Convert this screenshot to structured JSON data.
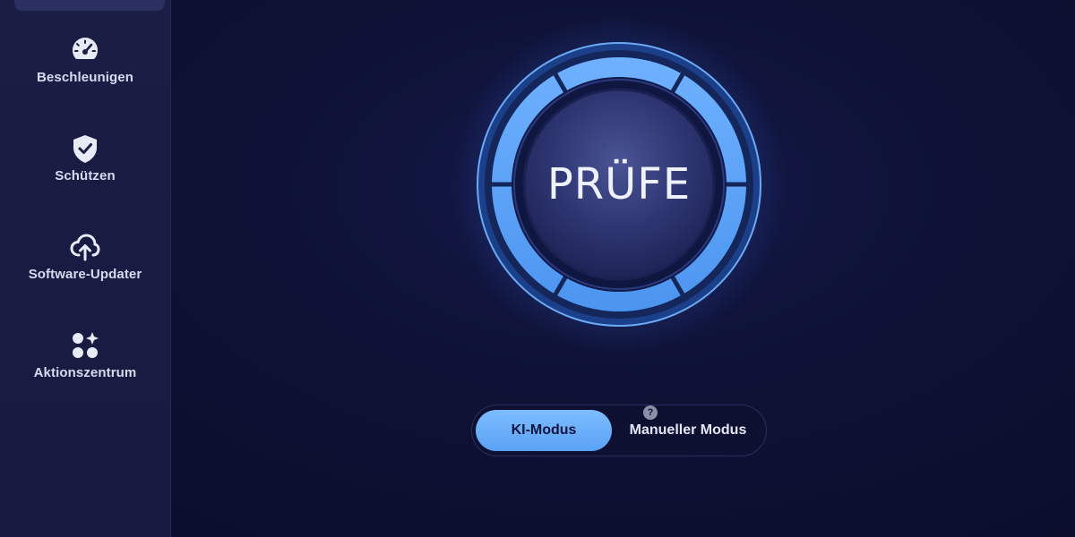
{
  "sidebar": {
    "items": [
      {
        "label": "Beschleunigen",
        "icon": "speedometer-icon"
      },
      {
        "label": "Schützen",
        "icon": "shield-check-icon"
      },
      {
        "label": "Software-Updater",
        "icon": "cloud-upload-icon"
      },
      {
        "label": "Aktionszentrum",
        "icon": "apps-sparkle-icon"
      }
    ]
  },
  "scan": {
    "button_label": "PRÜFE"
  },
  "mode_toggle": {
    "help_symbol": "?",
    "options": [
      {
        "label": "KI-Modus",
        "selected": true
      },
      {
        "label": "Manueller Modus",
        "selected": false
      }
    ]
  },
  "colors": {
    "accent": "#5aa2f5",
    "background": "#0c0f2c",
    "sidebar": "#1a1d44"
  }
}
